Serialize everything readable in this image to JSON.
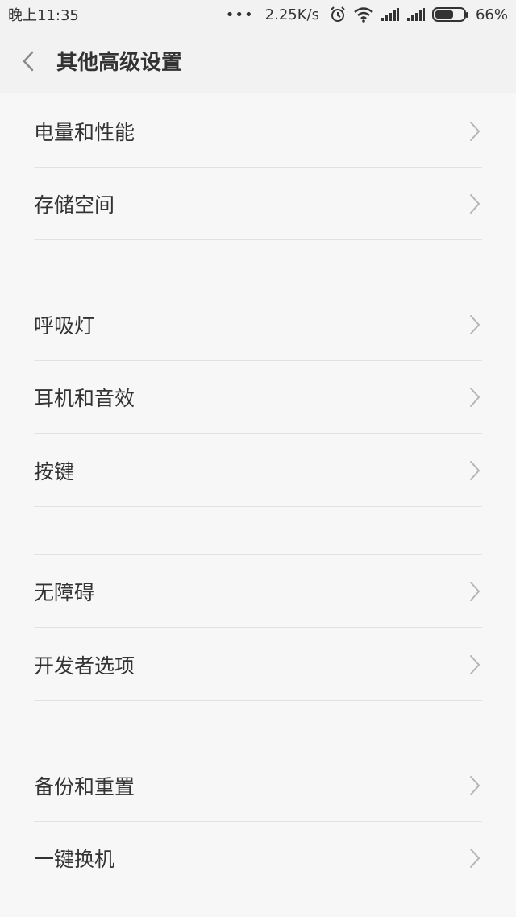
{
  "status_bar": {
    "time": "晚上11:35",
    "dots": "•••",
    "speed": "2.25K/s",
    "battery_percent": "66%",
    "battery_level": 0.66,
    "icons": [
      "alarm-icon",
      "wifi-icon",
      "signal-icon",
      "signal-icon",
      "battery-icon"
    ]
  },
  "header": {
    "title": "其他高级设置",
    "back_icon": "chevron-left-icon"
  },
  "groups": [
    {
      "items": [
        {
          "label": "电量和性能"
        },
        {
          "label": "存储空间"
        }
      ]
    },
    {
      "items": [
        {
          "label": "呼吸灯"
        },
        {
          "label": "耳机和音效"
        },
        {
          "label": "按键"
        }
      ]
    },
    {
      "items": [
        {
          "label": "无障碍"
        },
        {
          "label": "开发者选项"
        }
      ]
    },
    {
      "items": [
        {
          "label": "备份和重置"
        },
        {
          "label": "一键换机"
        }
      ]
    }
  ],
  "colors": {
    "background": "#f7f7f7",
    "bar": "#f2f2f2",
    "text": "#333333",
    "divider": "#e2e2e2",
    "chevron": "#b5b5b5"
  }
}
